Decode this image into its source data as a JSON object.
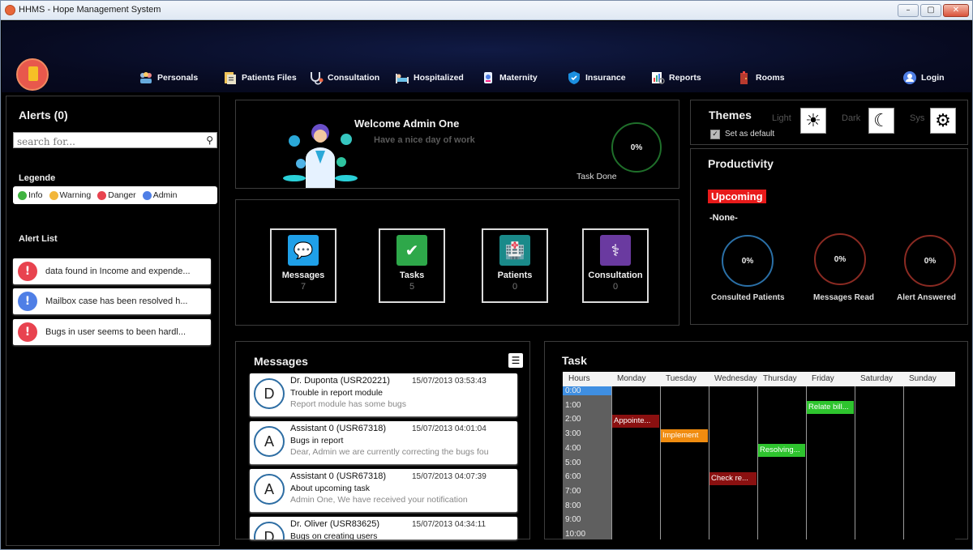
{
  "window": {
    "title": "HHMS - Hope Management System",
    "controls": {
      "minimize": "–",
      "maximize": "▢",
      "close": "✕"
    }
  },
  "nav": {
    "items": [
      {
        "label": "Personals",
        "icon": "personals-icon"
      },
      {
        "label": "Patients Files",
        "icon": "patients-files-icon"
      },
      {
        "label": "Consultation",
        "icon": "stethoscope-icon"
      },
      {
        "label": "Hospitalized",
        "icon": "bed-icon"
      },
      {
        "label": "Maternity",
        "icon": "maternity-icon"
      },
      {
        "label": "Insurance",
        "icon": "shield-icon"
      },
      {
        "label": "Reports",
        "icon": "reports-icon"
      },
      {
        "label": "Rooms",
        "icon": "door-icon"
      },
      {
        "label": "Login",
        "icon": "user-icon"
      }
    ]
  },
  "alerts": {
    "title": "Alerts (0)",
    "search_placeholder": "search for...",
    "legend_title": "Legende",
    "legend": [
      {
        "label": "Info",
        "color": "#3fb33f"
      },
      {
        "label": "Warning",
        "color": "#f2b63a"
      },
      {
        "label": "Danger",
        "color": "#e8434f"
      },
      {
        "label": "Admin",
        "color": "#4f7fe6"
      }
    ],
    "list_title": "Alert List",
    "items": [
      {
        "text": "data found in Income and expende...",
        "color": "#e8434f"
      },
      {
        "text": "Mailbox case has been resolved h...",
        "color": "#4f7fe6"
      },
      {
        "text": "Bugs in user seems to been hardl...",
        "color": "#e8434f"
      }
    ]
  },
  "welcome": {
    "title": "Welcome Admin One",
    "subtitle": "Have a nice day of work",
    "task_done_value": "0%",
    "task_done_label": "Task Done"
  },
  "stats": [
    {
      "label": "Messages",
      "value": "7",
      "color": "#1fa0e8",
      "glyph": "💬"
    },
    {
      "label": "Tasks",
      "value": "5",
      "color": "#2ea84a",
      "glyph": "✔"
    },
    {
      "label": "Patients",
      "value": "0",
      "color": "#1a8a8a",
      "glyph": "🏥"
    },
    {
      "label": "Consultation",
      "value": "0",
      "color": "#6a3aa0",
      "glyph": "⚕"
    }
  ],
  "themes": {
    "title": "Themes",
    "light": "Light",
    "dark": "Dark",
    "sys": "Sys",
    "default_label": "Set as default",
    "default_checked": true
  },
  "productivity": {
    "title": "Productivity",
    "upcoming": "Upcoming",
    "upcoming_value": "-None-",
    "rings": [
      {
        "value": "0%",
        "label": "Consulted Patients",
        "color": "#2a6fa6"
      },
      {
        "value": "0%",
        "label": "Messages Read",
        "color": "#8a2a22"
      },
      {
        "value": "0%",
        "label": "Alert Answered",
        "color": "#8a2a22"
      }
    ]
  },
  "messages": {
    "title": "Messages",
    "menu_glyph": "☰",
    "items": [
      {
        "initial": "D",
        "from": "Dr. Duponta (USR20221)",
        "date": "15/07/2013 03:53:43",
        "subject": "Trouble in report module",
        "body": "Report module has some bugs"
      },
      {
        "initial": "A",
        "from": "Assistant 0 (USR67318)",
        "date": "15/07/2013 04:01:04",
        "subject": "Bugs in report",
        "body": "Dear, Admin we are currently correcting the bugs fou"
      },
      {
        "initial": "A",
        "from": "Assistant 0 (USR67318)",
        "date": "15/07/2013 04:07:39",
        "subject": "About upcoming task",
        "body": "Admin One, We have received your notification"
      },
      {
        "initial": "D",
        "from": "Dr. Oliver (USR83625)",
        "date": "15/07/2013 04:34:11",
        "subject": "Bugs on creating users",
        "body": ""
      }
    ]
  },
  "task": {
    "title": "Task",
    "hours_header": "Hours",
    "days": [
      "Monday",
      "Tuesday",
      "Wednesday",
      "Thursday",
      "Friday",
      "Saturday",
      "Sunday"
    ],
    "hours": [
      "0:00",
      "1:00",
      "2:00",
      "3:00",
      "4:00",
      "5:00",
      "6:00",
      "7:00",
      "8:00",
      "9:00",
      "10:00"
    ],
    "selected_hour": "0:00",
    "events": [
      {
        "label": "Appointe...",
        "day": "Monday",
        "hour": "2:00",
        "color": "#8a1010"
      },
      {
        "label": "Implement",
        "day": "Tuesday",
        "hour": "3:00",
        "color": "#f08c10"
      },
      {
        "label": "Check re...",
        "day": "Wednesday",
        "hour": "6:00",
        "color": "#8a1010"
      },
      {
        "label": "Resolving...",
        "day": "Thursday",
        "hour": "4:00",
        "color": "#2ec42e"
      },
      {
        "label": "Relate bill...",
        "day": "Friday",
        "hour": "1:00",
        "color": "#2ec42e"
      }
    ]
  }
}
